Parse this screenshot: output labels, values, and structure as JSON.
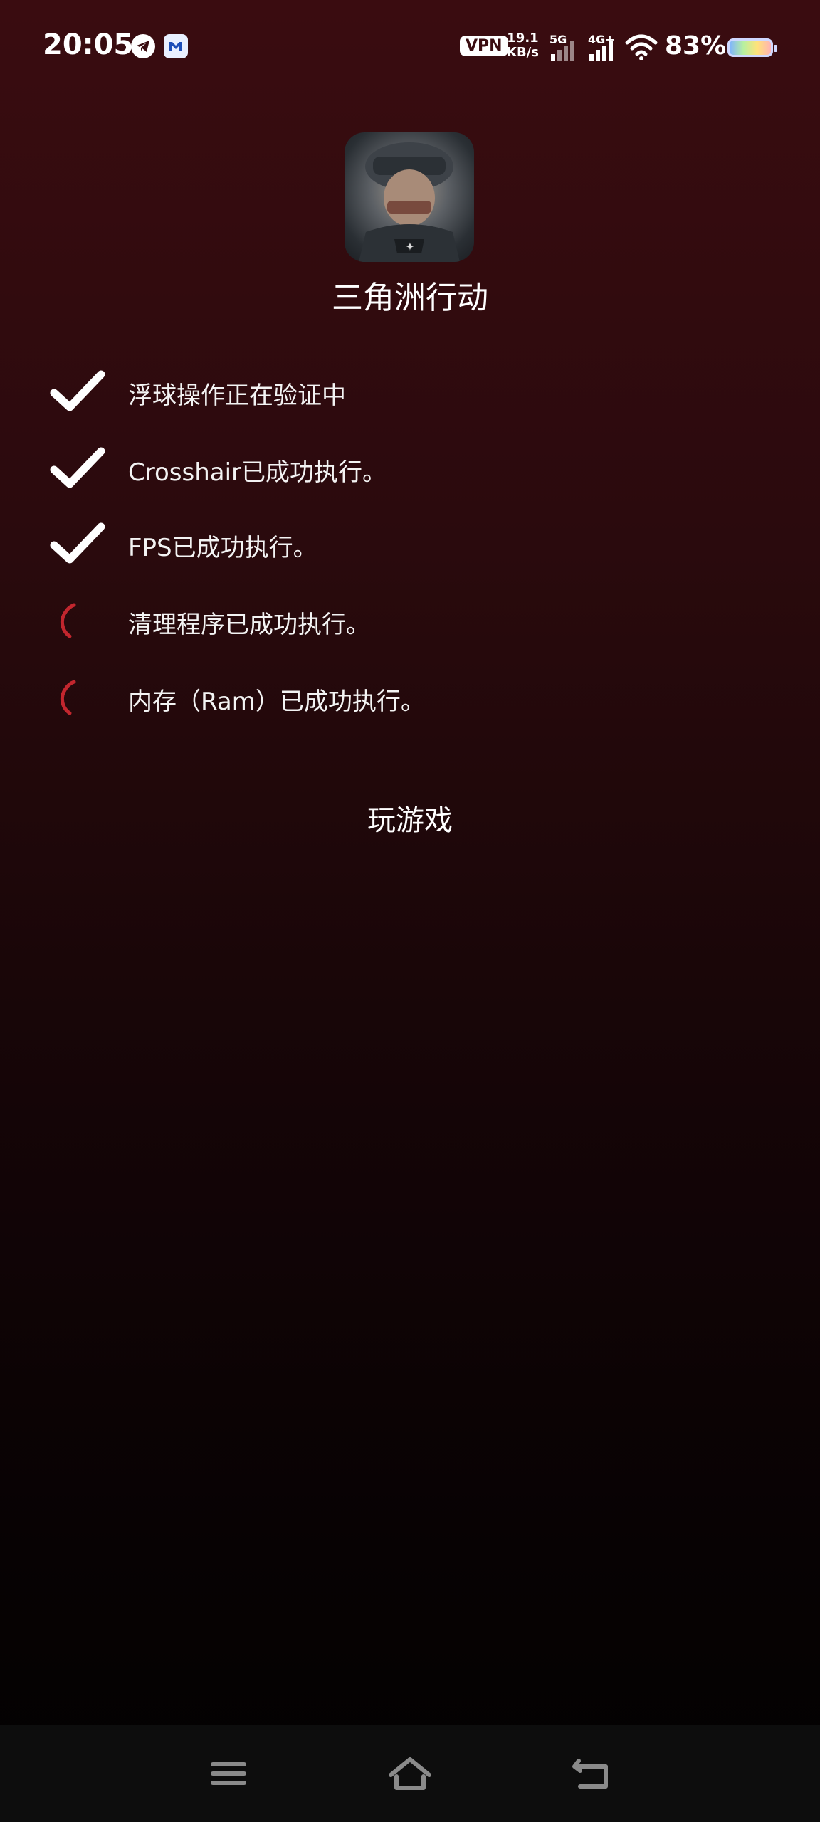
{
  "status_bar": {
    "time": "20:05",
    "vpn": "VPN",
    "speed_value": "19.1",
    "speed_unit": "KB/s",
    "network_1": "5G",
    "network_2": "4G+",
    "battery_percent": "83%"
  },
  "app": {
    "name": "三角洲行动",
    "icon": "soldier-app-icon"
  },
  "tasks": [
    {
      "label": "浮球操作正在验证中",
      "status": "done",
      "icon": "check-icon"
    },
    {
      "label": "Crosshair已成功执行。",
      "status": "done",
      "icon": "check-icon"
    },
    {
      "label": "FPS已成功执行。",
      "status": "done",
      "icon": "check-icon"
    },
    {
      "label": "清理程序已成功执行。",
      "status": "loading",
      "icon": "spinner-icon"
    },
    {
      "label": "内存（Ram）已成功执行。",
      "status": "loading",
      "icon": "spinner-icon"
    }
  ],
  "play_button": {
    "label": "玩游戏"
  },
  "colors": {
    "accent": "#c2262e",
    "background_top": "#3a0c10",
    "background_bottom": "#030101",
    "check": "#ffffff"
  }
}
